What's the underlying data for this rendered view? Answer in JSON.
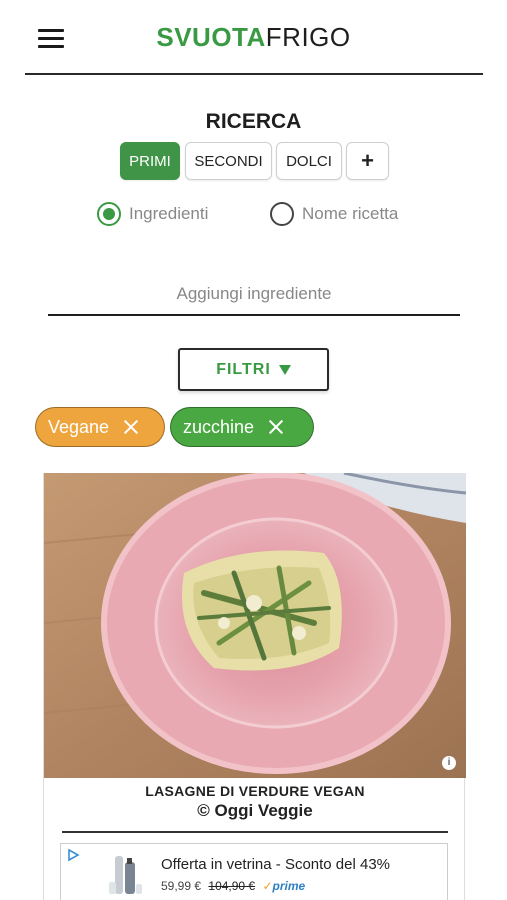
{
  "header": {
    "logo_part1": "SVUOTA",
    "logo_part2": "FRIGO",
    "menu_icon": "hamburger-menu-icon"
  },
  "search": {
    "title": "RICERCA",
    "tabs": [
      {
        "label": "PRIMI",
        "active": true
      },
      {
        "label": "SECONDI",
        "active": false
      },
      {
        "label": "DOLCI",
        "active": false
      },
      {
        "label": "+",
        "active": false
      }
    ],
    "modes": [
      {
        "label": "Ingredienti",
        "selected": true
      },
      {
        "label": "Nome ricetta",
        "selected": false
      }
    ],
    "ingredient_placeholder": "Aggiungi ingrediente",
    "filter_label": "FILTRI"
  },
  "filters": [
    {
      "label": "Vegane",
      "color": "#efa53d"
    },
    {
      "label": "zucchine",
      "color": "#49a842"
    }
  ],
  "recipe": {
    "title": "LASAGNE DI VERDURE VEGAN",
    "source": "© Oggi Veggie",
    "info_icon": "i"
  },
  "ad": {
    "title": "Offerta in vetrina - Sconto del 43%",
    "price": "59,99 €",
    "old_price": "104,90 €",
    "prime_check": "✓",
    "prime_label": "prime"
  },
  "colors": {
    "brand_green": "#3a9a44",
    "active_tab": "#3f9447",
    "chip_orange": "#efa53d",
    "chip_green": "#49a842"
  }
}
